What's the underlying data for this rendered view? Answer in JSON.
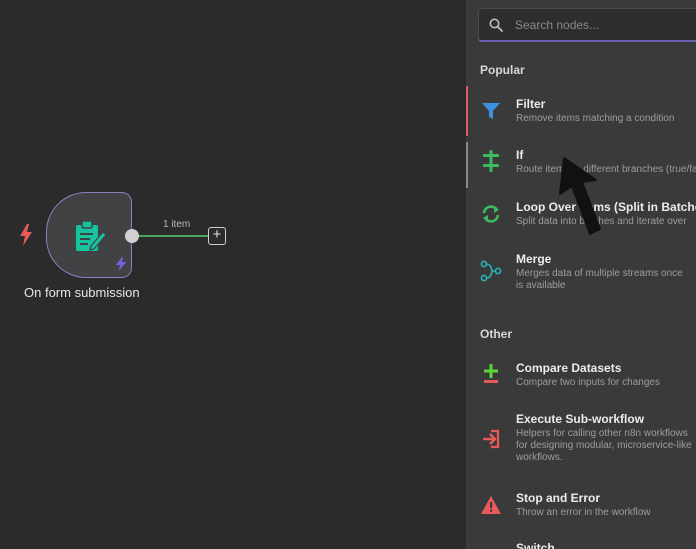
{
  "canvas": {
    "node": {
      "title": "On form submission",
      "icon": "form-edit-icon",
      "trigger_icon": "lightning-bolt-icon",
      "trigger_color": "#e85a5a",
      "icon_color": "#17c4a0",
      "border_color": "#8c7fc0"
    },
    "connection": {
      "label": "1 item",
      "line_color": "#4aa667"
    },
    "add_button_label": "+"
  },
  "panel": {
    "search": {
      "placeholder": "Search nodes...",
      "value": ""
    },
    "sections": [
      {
        "label": "Popular",
        "items": [
          {
            "title": "Filter",
            "desc": [
              "Remove items matching a condition"
            ],
            "icon": "filter-icon",
            "color": "#3d8fe0"
          },
          {
            "title": "If",
            "desc": [
              "Route items to different branches (true/false)"
            ],
            "icon": "if-branch-icon",
            "color": "#3fb95e"
          },
          {
            "title": "Loop Over Items (Split in Batches)",
            "desc": [
              "Split data into batches and iterate over"
            ],
            "icon": "loop-icon",
            "color": "#3fb95e"
          },
          {
            "title": "Merge",
            "desc": [
              "Merges data of multiple streams once",
              "is available"
            ],
            "icon": "merge-icon",
            "color": "#2ab2b2"
          }
        ]
      },
      {
        "label": "Other",
        "items": [
          {
            "title": "Compare Datasets",
            "desc": [
              "Compare two inputs for changes"
            ],
            "icon": "compare-icon",
            "color": "#5ad63a"
          },
          {
            "title": "Execute Sub-workflow",
            "desc": [
              "Helpers for calling other n8n workflows",
              "for designing modular, microservice-like",
              "workflows."
            ],
            "icon": "execute-workflow-icon",
            "color": "#e85a5a"
          },
          {
            "title": "Stop and Error",
            "desc": [
              "Throw an error in the workflow"
            ],
            "icon": "warning-icon",
            "color": "#e85a5a"
          },
          {
            "title": "Switch",
            "desc": [],
            "icon": "switch-icon",
            "color": "#3d8fe0"
          }
        ]
      }
    ]
  }
}
